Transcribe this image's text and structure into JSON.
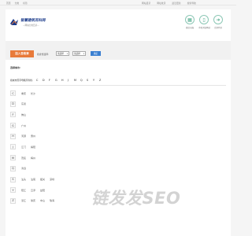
{
  "topbar": {
    "left_links": [
      "首页",
      "分类",
      "标签"
    ],
    "right_links": [
      "网站目录",
      "网址收录",
      "最近更新",
      "搜索导航"
    ]
  },
  "logo": {
    "title": "智慧建筑百科网",
    "subtitle": "—网站分类目录—"
  },
  "header_icons": [
    {
      "label": "微信扫描",
      "icon": "qr-icon"
    },
    {
      "label": "手机浏览网站",
      "icon": "mobile-icon"
    },
    {
      "label": "立即到访",
      "icon": "arrow-icon"
    }
  ],
  "toolbar": {
    "join_label": "加入百收录",
    "filter_label": "按省份选择:",
    "province_value": "请选择",
    "city_value": "请选择",
    "go_label": "确定"
  },
  "section": {
    "title": "选择城市:"
  },
  "letters": {
    "label": "按城市首字母顺序查找:",
    "items": [
      "C",
      "D",
      "F",
      "G",
      "H",
      "J",
      "M",
      "Q",
      "S",
      "Y",
      "Z"
    ]
  },
  "city_rows": [
    {
      "letter": "C",
      "cities": [
        "重庆",
        "长沙"
      ]
    },
    {
      "letter": "D",
      "cities": [
        "东莞"
      ]
    },
    {
      "letter": "F",
      "cities": [
        "佛山"
      ]
    },
    {
      "letter": "G",
      "cities": [
        "广州"
      ]
    },
    {
      "letter": "H",
      "cities": [
        "河源",
        "惠州"
      ]
    },
    {
      "letter": "J",
      "cities": [
        "江门",
        "揭阳"
      ]
    },
    {
      "letter": "M",
      "cities": [
        "茂名",
        "梅州"
      ]
    },
    {
      "letter": "Q",
      "cities": [
        "清远"
      ]
    },
    {
      "letter": "S",
      "cities": [
        "汕头",
        "汕尾",
        "韶关",
        "深圳"
      ]
    },
    {
      "letter": "Y",
      "cities": [
        "阳江",
        "云浮",
        "益阳"
      ]
    },
    {
      "letter": "Z",
      "cities": [
        "湛江",
        "肇庆",
        "中山",
        "珠海"
      ]
    }
  ],
  "watermark": "链发发SEO",
  "colors": {
    "join_button": "#e87a3a",
    "go_button": "#3a7fd1",
    "logo_title": "#1a3a8a",
    "icon_ring": "#8cc7b5"
  }
}
